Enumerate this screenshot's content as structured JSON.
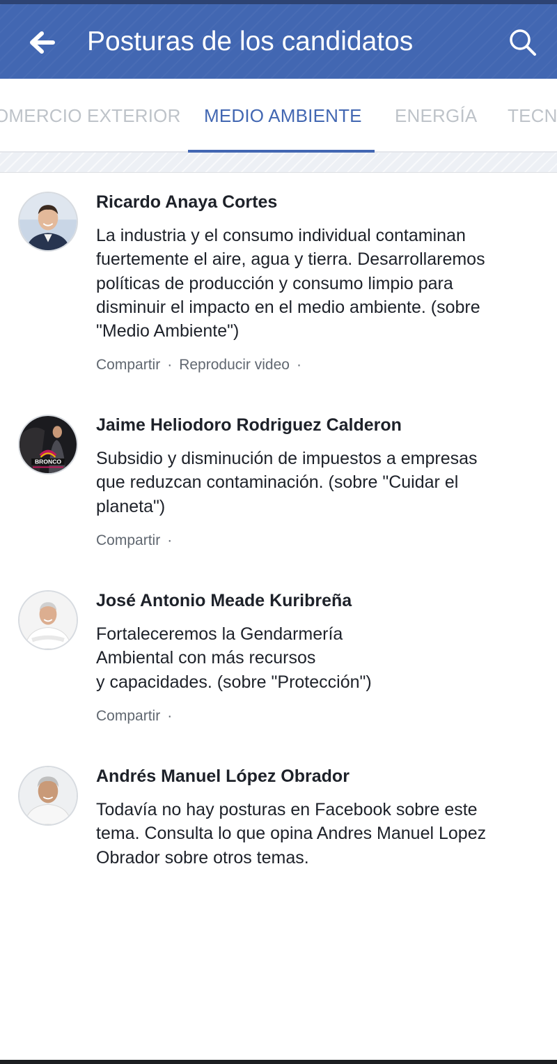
{
  "header": {
    "title": "Posturas de los candidatos",
    "back_icon": "arrow-left-icon",
    "search_icon": "search-icon",
    "color": "#4267b2"
  },
  "tabs": [
    {
      "label": "OMERCIO EXTERIOR",
      "active": false
    },
    {
      "label": "MEDIO AMBIENTE",
      "active": true
    },
    {
      "label": "ENERGÍA",
      "active": false
    },
    {
      "label": "TECNO",
      "active": false
    }
  ],
  "posts": [
    {
      "name": "Ricardo Anaya Cortes",
      "text_lines": [
        "La industria y el consumo individual contaminan",
        "fuertemente el aire, agua y tierra. Desarrollaremos",
        "políticas de producción y consumo limpio para",
        "disminuir el impacto en el medio ambiente. (sobre",
        "\"Medio Ambiente\")"
      ],
      "share_label": "Compartir",
      "video_label": "Reproducir video"
    },
    {
      "name": "Jaime Heliodoro Rodriguez Calderon",
      "text_lines": [
        "Subsidio y disminución de impuestos a empresas",
        "que reduzcan contaminación. (sobre \"Cuidar el",
        "planeta\")"
      ],
      "share_label": "Compartir",
      "avatar_logo_text": "BRONCO"
    },
    {
      "name": "José Antonio Meade Kuribreña",
      "text_lines": [
        "Fortaleceremos la Gendarmería",
        "Ambiental con más recursos",
        "y capacidades. (sobre \"Protección\")"
      ],
      "share_label": "Compartir"
    },
    {
      "name": "Andrés Manuel López Obrador",
      "text_lines": [
        "Todavía no hay posturas en Facebook sobre este",
        "tema. Consulta lo que opina Andres Manuel Lopez",
        "Obrador sobre otros temas."
      ]
    }
  ]
}
